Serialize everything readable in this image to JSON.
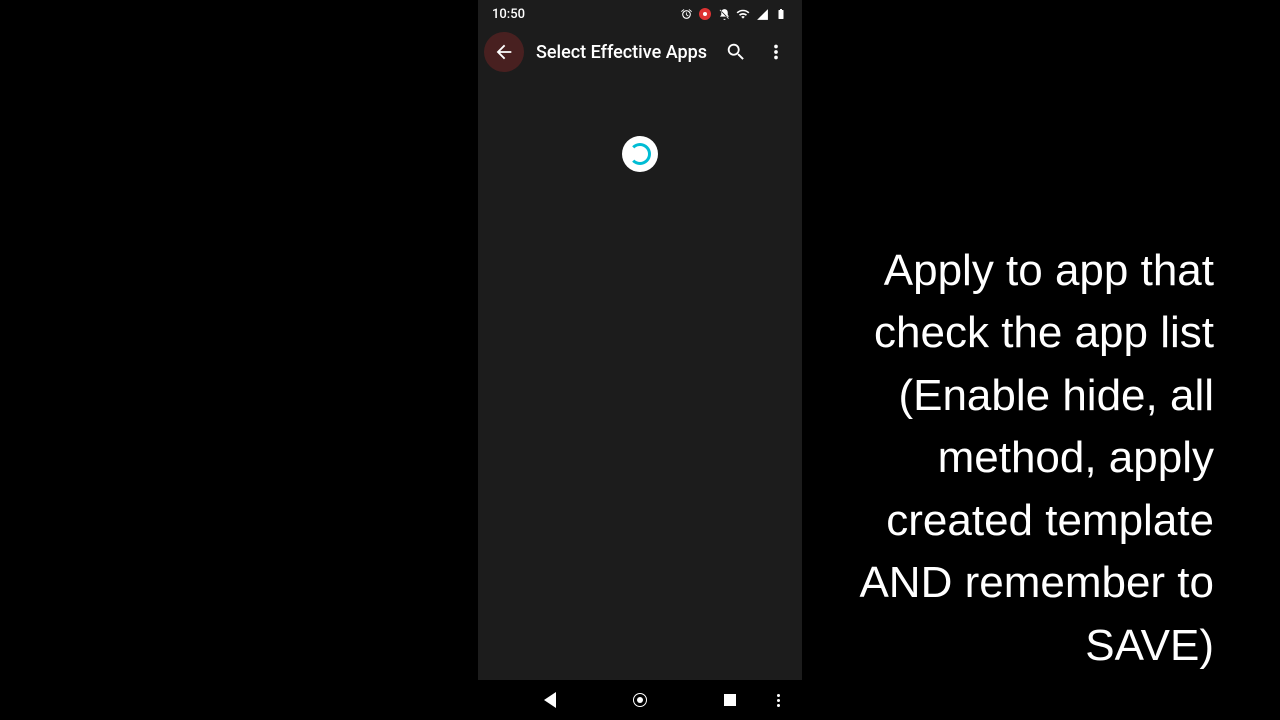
{
  "status": {
    "time": "10:50"
  },
  "appbar": {
    "title": "Select Effective Apps"
  },
  "annotation": {
    "text": "Apply to app that check the app list (Enable hide, all method, apply created template AND remember to SAVE)"
  }
}
